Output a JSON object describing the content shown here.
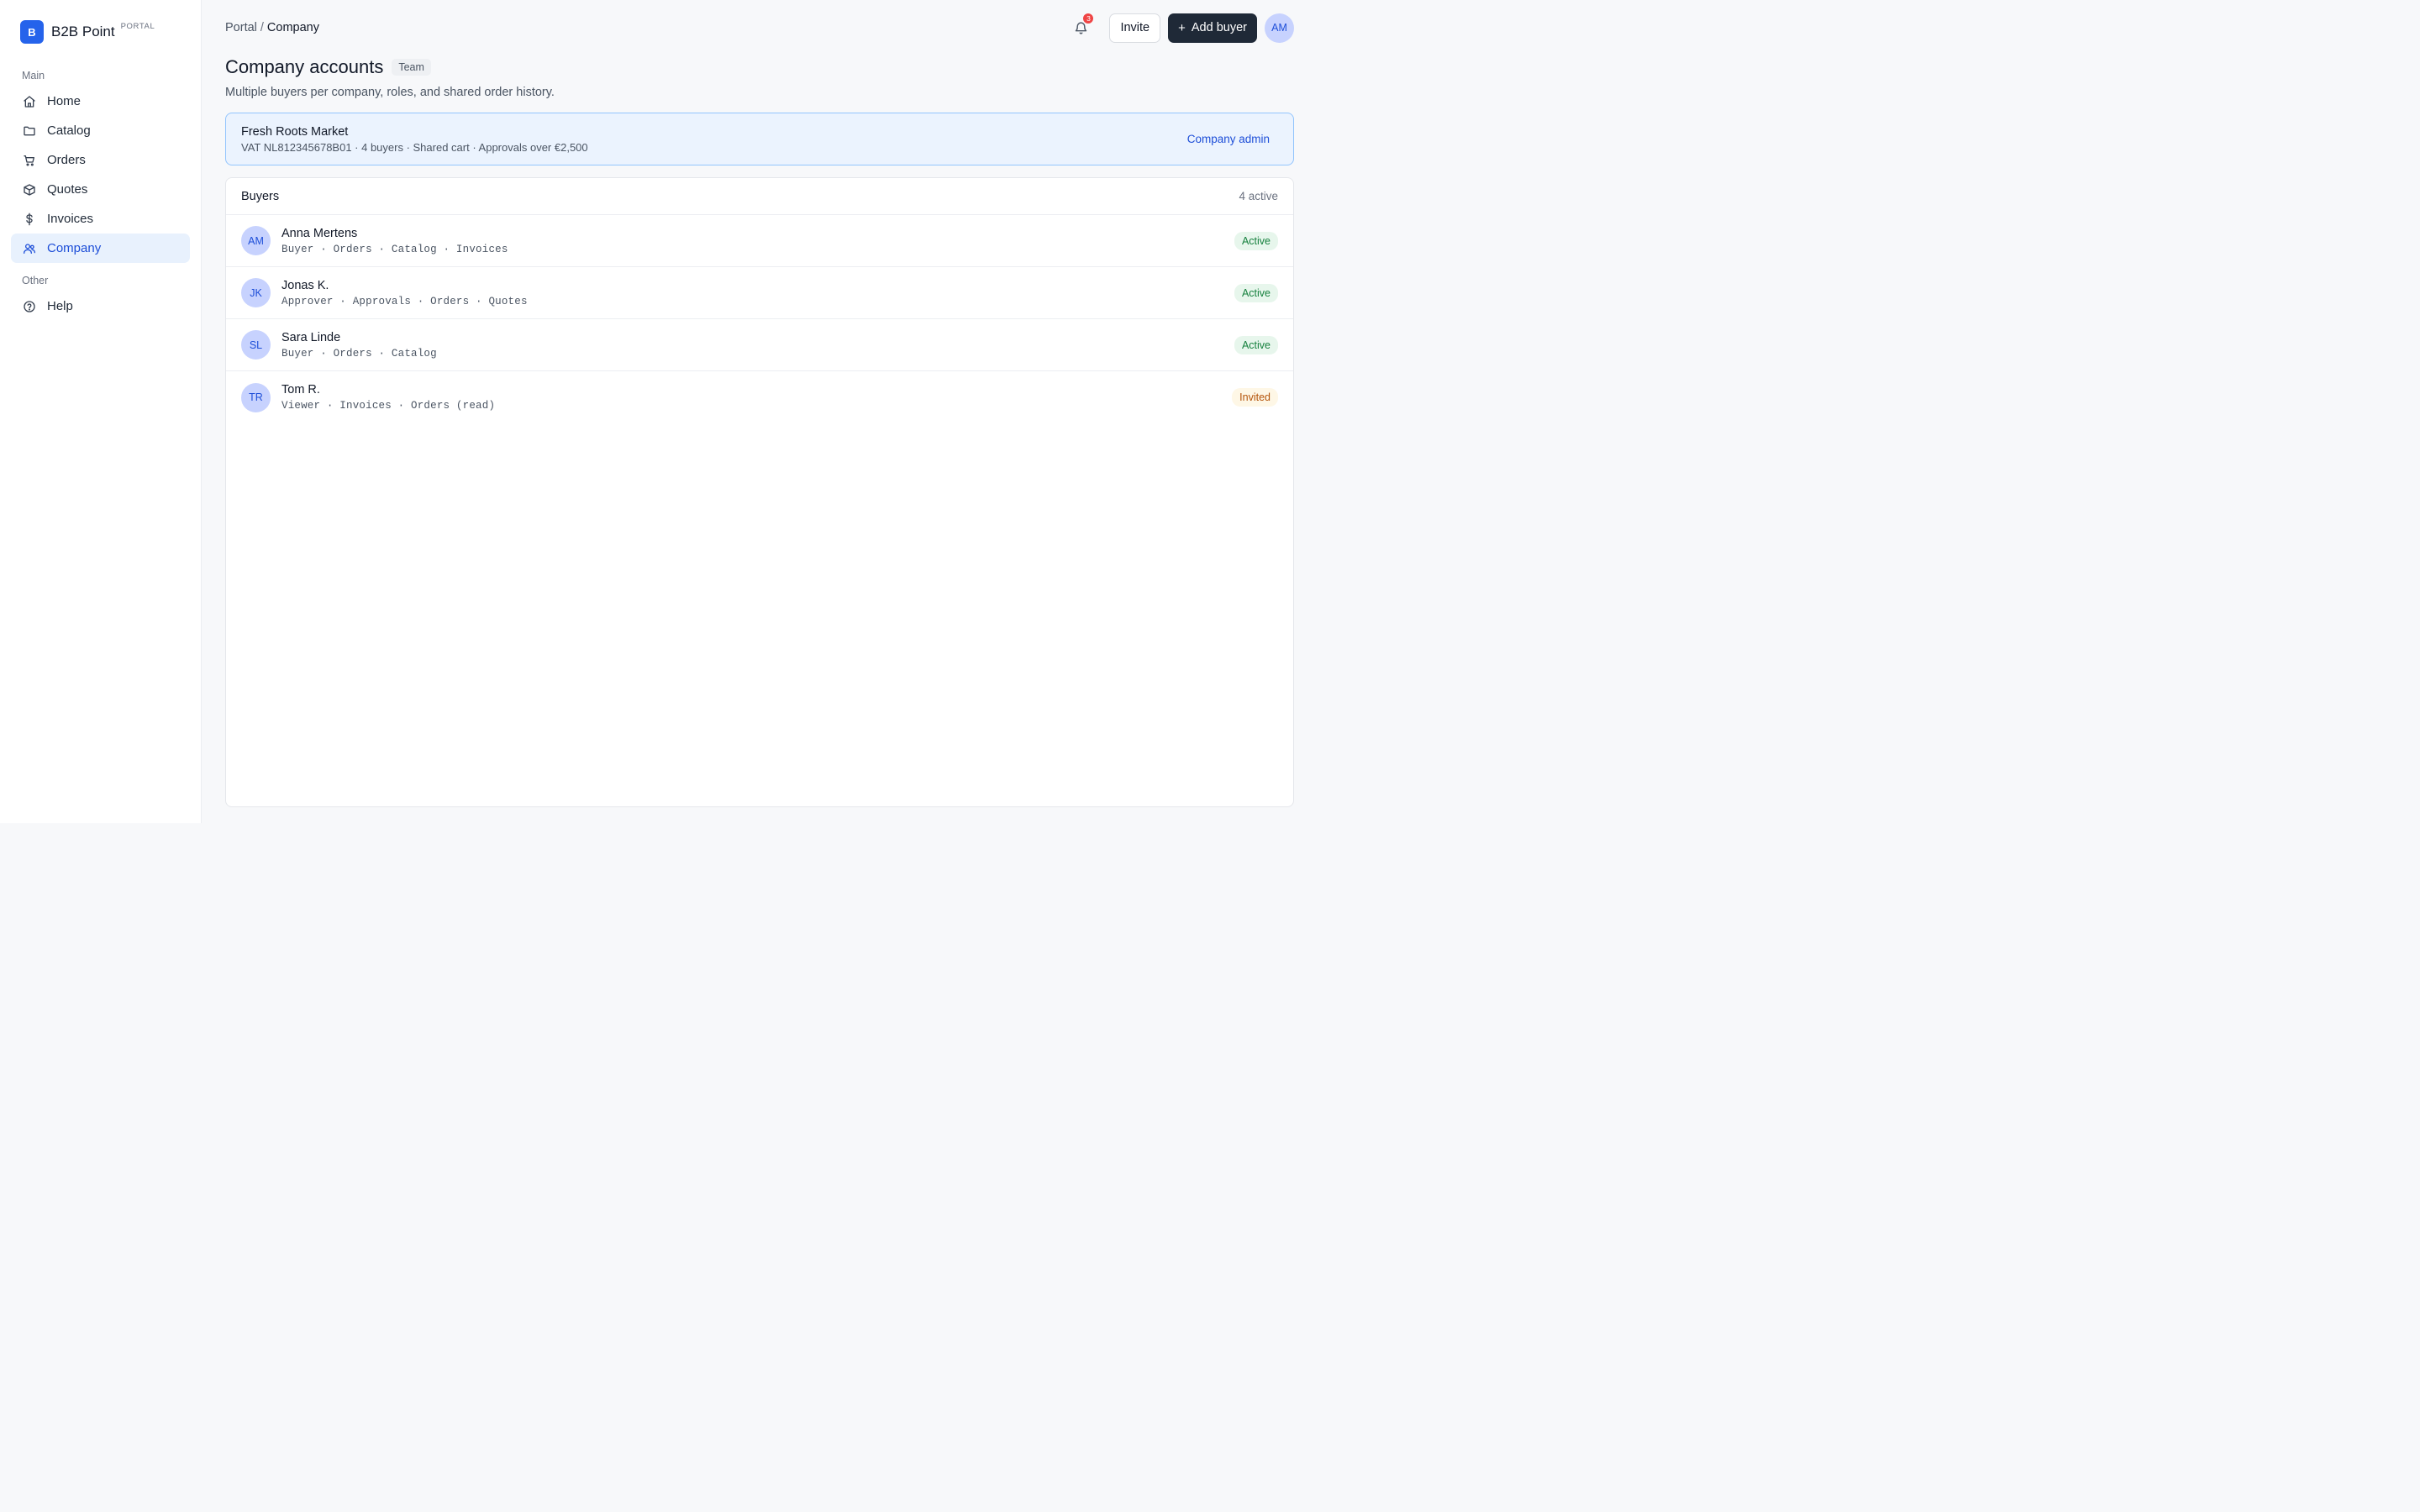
{
  "brand": {
    "logo_letter": "B",
    "name": "B2B Point",
    "tag": "PORTAL",
    "color": "#2563eb"
  },
  "sidebar": {
    "sections": [
      {
        "heading": "Main",
        "items": [
          {
            "label": "Home",
            "icon": "home-icon"
          },
          {
            "label": "Catalog",
            "icon": "folder-icon"
          },
          {
            "label": "Orders",
            "icon": "cart-icon"
          },
          {
            "label": "Quotes",
            "icon": "box-icon"
          },
          {
            "label": "Invoices",
            "icon": "dollar-icon"
          },
          {
            "label": "Company",
            "icon": "users-icon",
            "active": true
          }
        ]
      },
      {
        "heading": "Other",
        "items": [
          {
            "label": "Help",
            "icon": "help-circle-icon"
          }
        ]
      }
    ]
  },
  "header": {
    "breadcrumb": {
      "root": "Portal",
      "separator": "/",
      "current": "Company"
    },
    "notifications_count": "3",
    "invite_label": "Invite",
    "add_buyer_label": "Add buyer",
    "add_buyer_icon": "plus-icon",
    "user_initials": "AM"
  },
  "page": {
    "title": "Company accounts",
    "tag": "Team",
    "subtitle": "Multiple buyers per company, roles, and shared order history."
  },
  "company": {
    "name": "Fresh Roots Market",
    "meta": "VAT NL812345678B01 · 4 buyers · Shared cart · Approvals over €2,500",
    "role": "Company admin"
  },
  "buyers": {
    "title": "Buyers",
    "count": "4 active",
    "rows": [
      {
        "initials": "AM",
        "name": "Anna Mertens",
        "roles": "Buyer · Orders · Catalog · Invoices",
        "status": "Active",
        "status_type": "active"
      },
      {
        "initials": "JK",
        "name": "Jonas K.",
        "roles": "Approver · Approvals · Orders · Quotes",
        "status": "Active",
        "status_type": "active"
      },
      {
        "initials": "SL",
        "name": "Sara Linde",
        "roles": "Buyer · Orders · Catalog",
        "status": "Active",
        "status_type": "active"
      },
      {
        "initials": "TR",
        "name": "Tom R.",
        "roles": "Viewer · Invoices · Orders (read)",
        "status": "Invited",
        "status_type": "invited"
      }
    ]
  },
  "colors": {
    "accent": "#1d4ed8",
    "primary_button": "#1f2937",
    "active_status": "#15803d",
    "invited_status": "#b45309",
    "notification": "#ef4444"
  }
}
